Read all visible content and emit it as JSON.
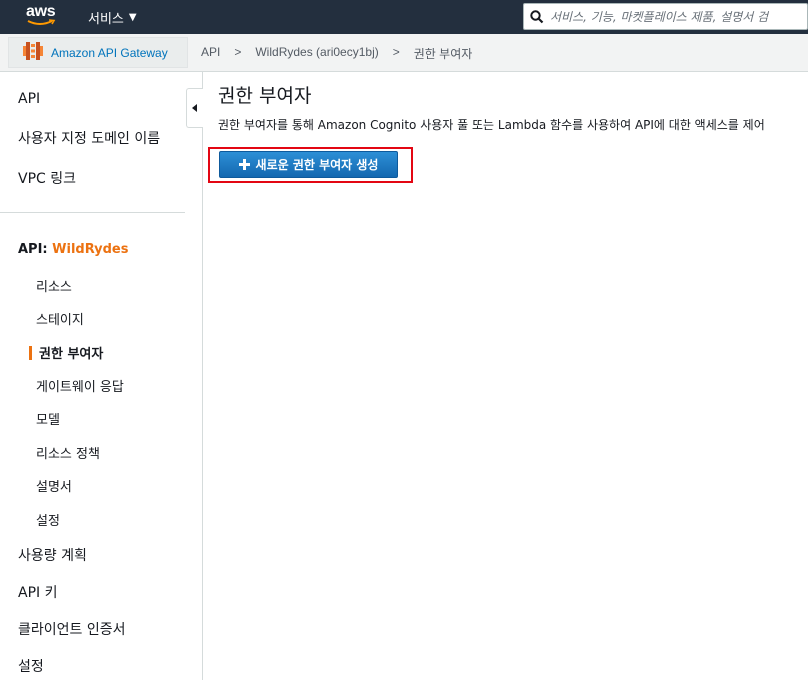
{
  "topnav": {
    "logo_text": "aws",
    "services_label": "서비스",
    "search_placeholder": "서비스, 기능, 마켓플레이스 제품, 설명서 검"
  },
  "breadcrumb": {
    "service_name": "Amazon API Gateway",
    "items": [
      "API",
      "WildRydes (ari0ecy1bj)",
      "권한 부여자"
    ],
    "separator": ">"
  },
  "sidebar": {
    "top_items": [
      "API",
      "사용자 지정 도메인 이름",
      "VPC 링크"
    ],
    "api_prefix": "API: ",
    "api_name": "WildRydes",
    "sub_items": [
      "리소스",
      "스테이지",
      "권한 부여자",
      "게이트웨이 응답",
      "모델",
      "리소스 정책",
      "설명서",
      "설정"
    ],
    "active_sub": "권한 부여자",
    "bottom_items": [
      "사용량 계획",
      "API 키",
      "클라이언트 인증서",
      "설정"
    ]
  },
  "main": {
    "title": "권한 부여자",
    "description": "권한 부여자를 통해 Amazon Cognito 사용자 풀 또는 Lambda 함수를 사용하여 API에 대한 액세스를 제어",
    "create_button": "새로운 권한 부여자 생성"
  },
  "colors": {
    "nav_bg": "#232f3e",
    "accent_orange": "#ec7211",
    "link_blue": "#0073bb",
    "button_blue": "#1d7bc6",
    "highlight_red": "#e30613"
  }
}
